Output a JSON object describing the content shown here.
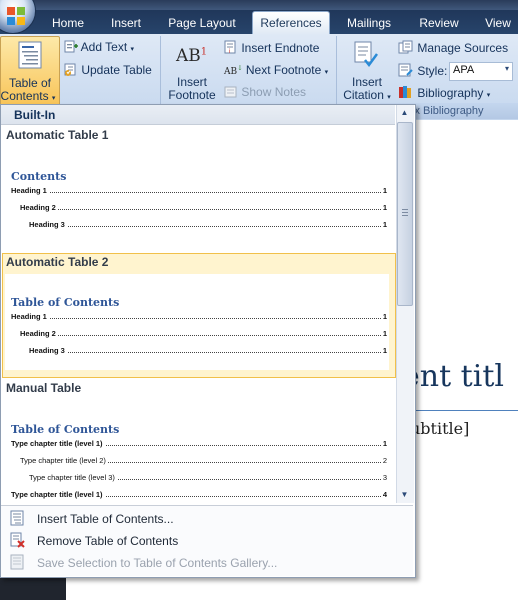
{
  "tabs": [
    "Home",
    "Insert",
    "Page Layout",
    "References",
    "Mailings",
    "Review",
    "View"
  ],
  "active_tab": "References",
  "ribbon": {
    "toc_group": {
      "toc_button": [
        "Table of",
        "Contents"
      ],
      "add_text": "Add Text",
      "update_table": "Update Table"
    },
    "footnotes_group": {
      "insert_footnote": [
        "Insert",
        "Footnote"
      ],
      "footnote_glyph": "AB",
      "footnote_sup": "1",
      "insert_endnote": "Insert Endnote",
      "next_footnote": "Next Footnote",
      "next_glyph": "AB",
      "show_notes": "Show Notes"
    },
    "citations_group": {
      "insert_citation": [
        "Insert",
        "Citation"
      ],
      "manage_sources": "Manage Sources",
      "style_label": "Style:",
      "style_value": "APA",
      "bibliography": "Bibliography",
      "group_label": "x Bibliography"
    }
  },
  "dropdown": {
    "header": "Built-In",
    "sections": [
      {
        "title": "Automatic Table 1",
        "preview_title": "Contents",
        "lines": [
          {
            "text": "Heading 1",
            "page": "1"
          },
          {
            "text": "Heading 2",
            "page": "1"
          },
          {
            "text": "Heading 3",
            "page": "1"
          }
        ]
      },
      {
        "title": "Automatic Table 2",
        "preview_title": "Table of Contents",
        "lines": [
          {
            "text": "Heading 1",
            "page": "1"
          },
          {
            "text": "Heading 2",
            "page": "1"
          },
          {
            "text": "Heading 3",
            "page": "1"
          }
        ]
      },
      {
        "title": "Manual Table",
        "preview_title": "Table of Contents",
        "lines": [
          {
            "text": "Type chapter title (level 1)",
            "page": "1"
          },
          {
            "text": "Type chapter title (level 2)",
            "page": "2"
          },
          {
            "text": "Type chapter title (level 3)",
            "page": "3"
          },
          {
            "text": "Type chapter title (level 1)",
            "page": "4"
          }
        ]
      }
    ],
    "menu": [
      {
        "label": "Insert Table of Contents...",
        "disabled": false
      },
      {
        "label": "Remove Table of Contents",
        "disabled": false
      },
      {
        "label": "Save Selection to Table of Contents Gallery...",
        "disabled": true
      }
    ]
  },
  "document": {
    "title": "ent titl",
    "subtitle": "ubtitle]"
  },
  "colors": {
    "ribbon_bg": "#dfe9f6",
    "accent_hover": "#f8c458",
    "heading_blue": "#2e5597",
    "doc_title": "#17365d",
    "rule_blue": "#4f81bd"
  },
  "icons": [
    "office-button-icon",
    "table-of-contents-icon",
    "add-text-icon",
    "update-table-icon",
    "insert-footnote-icon",
    "insert-endnote-icon",
    "next-footnote-icon",
    "show-notes-icon",
    "insert-citation-icon",
    "manage-sources-icon",
    "style-icon",
    "bibliography-icon",
    "insert-toc-icon",
    "remove-toc-icon",
    "save-selection-icon"
  ]
}
